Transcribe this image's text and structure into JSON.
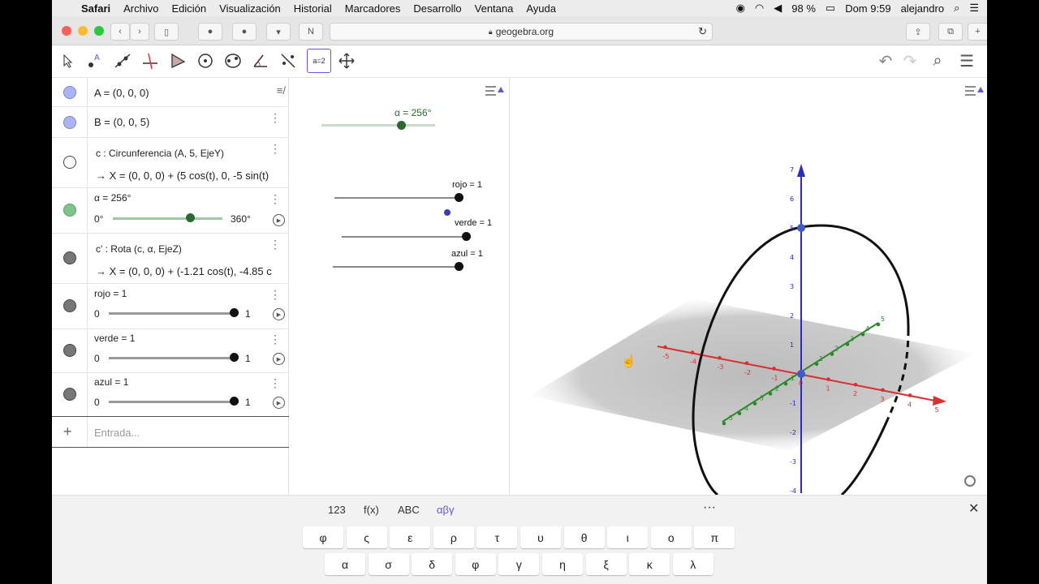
{
  "menubar": {
    "app": "Safari",
    "items": [
      "Archivo",
      "Edición",
      "Visualización",
      "Historial",
      "Marcadores",
      "Desarrollo",
      "Ventana",
      "Ayuda"
    ],
    "battery": "98 %",
    "clock": "Dom 9:59",
    "user": "alejandro"
  },
  "browser": {
    "url": "geogebra.org"
  },
  "algebra": {
    "a": "A = (0, 0, 0)",
    "b": "B = (0, 0, 5)",
    "c_def": "c : Circunferencia (A, 5, EjeY)",
    "c_val": "→ X = (0, 0, 0) + (5 cos(t), 0, -5 sin(t)",
    "alpha": "α = 256°",
    "alpha_min": "0°",
    "alpha_max": "360°",
    "alpha_fraction": 0.711,
    "cp_def": "c' : Rota (c, α, EjeZ)",
    "cp_val": "→ X = (0, 0, 0) + (-1.21 cos(t), -4.85 c",
    "rojo": "rojo = 1",
    "rojo_min": "0",
    "rojo_max": "1",
    "verde": "verde = 1",
    "verde_min": "0",
    "verde_max": "1",
    "azul": "azul = 1",
    "azul_min": "0",
    "azul_max": "1",
    "input_placeholder": "Entrada..."
  },
  "graphics2": {
    "alpha": "α = 256°",
    "rojo": "rojo = 1",
    "verde": "verde = 1",
    "azul": "azul = 1"
  },
  "axes3d": {
    "z_ticks": [
      "7",
      "6",
      "5",
      "4",
      "3",
      "2",
      "1",
      "-1",
      "-2",
      "-3",
      "-4"
    ],
    "x_ticks": [
      "-5",
      "-4",
      "-3",
      "-2",
      "-1",
      "0",
      "1",
      "2",
      "3",
      "4",
      "5"
    ],
    "y_ticks": [
      "-5",
      "-4",
      "-3",
      "-2",
      "-1",
      "1",
      "2",
      "3",
      "4",
      "5"
    ]
  },
  "colors": {
    "accent": "#6557d2",
    "axis_x": "#d93030",
    "axis_y": "#2a8a2a",
    "axis_z": "#2a2ac8",
    "point": "#3d5ccc"
  },
  "keyboard": {
    "tabs": [
      "123",
      "f(x)",
      "ABC",
      "αβγ"
    ],
    "more": "···",
    "close": "✕",
    "row1": [
      "φ",
      "ς",
      "ε",
      "ρ",
      "τ",
      "υ",
      "θ",
      "ι",
      "ο",
      "π"
    ],
    "row2": [
      "α",
      "σ",
      "δ",
      "φ",
      "γ",
      "η",
      "ξ",
      "κ",
      "λ"
    ]
  }
}
